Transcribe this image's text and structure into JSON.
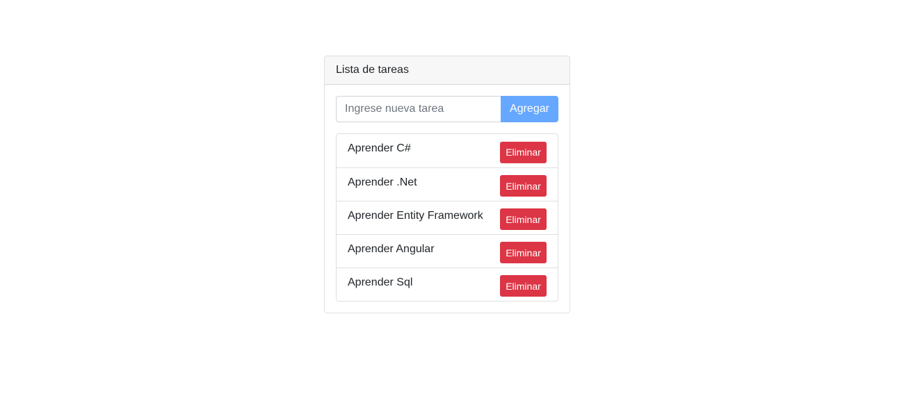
{
  "card": {
    "title": "Lista de tareas"
  },
  "form": {
    "placeholder": "Ingrese nueva tarea",
    "value": "",
    "add_label": "Agregar"
  },
  "tasks": [
    {
      "text": "Aprender C#",
      "delete_label": "Eliminar"
    },
    {
      "text": "Aprender .Net",
      "delete_label": "Eliminar"
    },
    {
      "text": "Aprender Entity Framework",
      "delete_label": "Eliminar"
    },
    {
      "text": "Aprender Angular",
      "delete_label": "Eliminar"
    },
    {
      "text": "Aprender Sql",
      "delete_label": "Eliminar"
    }
  ],
  "colors": {
    "add_button": "#66a8ff",
    "delete_button": "#dc3545",
    "header_bg": "#f7f7f7"
  }
}
